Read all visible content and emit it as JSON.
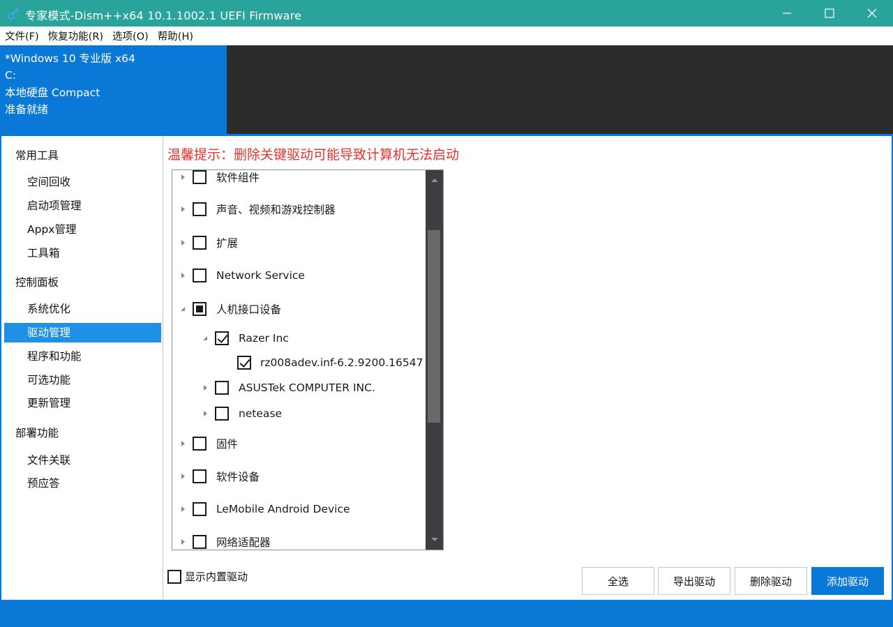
{
  "window": {
    "title": "专家模式-Dism++x64 10.1.1002.1 UEFI Firmware",
    "minimize_glyph": "—",
    "maximize_glyph": "☐",
    "close_glyph": "✕"
  },
  "menu": [
    {
      "label": "文件(F)"
    },
    {
      "label": "恢复功能(R)"
    },
    {
      "label": "选项(O)"
    },
    {
      "label": "帮助(H)"
    }
  ],
  "image_info": {
    "name": "*Windows 10 专业版 x64",
    "drive": "C:",
    "disk": "本地硬盘 Compact",
    "status": "准备就绪"
  },
  "sidebar": {
    "groups": [
      {
        "label": "常用工具",
        "items": [
          {
            "label": "空间回收"
          },
          {
            "label": "启动项管理"
          },
          {
            "label": "Appx管理"
          },
          {
            "label": "工具箱"
          }
        ]
      },
      {
        "label": "控制面板",
        "items": [
          {
            "label": "系统优化"
          },
          {
            "label": "驱动管理"
          },
          {
            "label": "程序和功能"
          },
          {
            "label": "可选功能"
          },
          {
            "label": "更新管理"
          }
        ]
      },
      {
        "label": "部署功能",
        "items": [
          {
            "label": "文件关联"
          },
          {
            "label": "预应答"
          }
        ]
      }
    ],
    "selected": "驱动管理"
  },
  "main": {
    "warning": "温馨提示：删除关键驱动可能导致计算机无法启动",
    "tree": [
      {
        "label": "软件组件",
        "state": "unchecked",
        "expander": "collapsed",
        "level": 0
      },
      {
        "label": "声音、视频和游戏控制器",
        "state": "unchecked",
        "expander": "collapsed",
        "level": 0
      },
      {
        "label": "扩展",
        "state": "unchecked",
        "expander": "collapsed",
        "level": 0
      },
      {
        "label": "Network Service",
        "state": "unchecked",
        "expander": "collapsed",
        "level": 0
      },
      {
        "label": "人机接口设备",
        "state": "partial",
        "expander": "expanded",
        "level": 0
      },
      {
        "label": "Razer Inc",
        "state": "checked",
        "expander": "expanded",
        "level": 1
      },
      {
        "label": "rz008adev.inf-6.2.9200.16547",
        "state": "checked",
        "expander": "none",
        "level": 2
      },
      {
        "label": "ASUSTek COMPUTER INC.",
        "state": "unchecked",
        "expander": "collapsed",
        "level": 1
      },
      {
        "label": "netease",
        "state": "unchecked",
        "expander": "collapsed",
        "level": 1
      },
      {
        "label": "固件",
        "state": "unchecked",
        "expander": "collapsed",
        "level": 0
      },
      {
        "label": "软件设备",
        "state": "unchecked",
        "expander": "collapsed",
        "level": 0
      },
      {
        "label": "LeMobile Android Device",
        "state": "unchecked",
        "expander": "collapsed",
        "level": 0
      },
      {
        "label": "网络适配器",
        "state": "unchecked",
        "expander": "collapsed",
        "level": 0
      }
    ],
    "show_builtin_label": "显示内置驱动",
    "buttons": {
      "select_all": "全选",
      "export": "导出驱动",
      "delete": "删除驱动",
      "add": "添加驱动"
    }
  },
  "colors": {
    "titlebar": "#2aa39a",
    "accent": "#0a78d7",
    "selected_item": "#1e90e6",
    "header_dark": "#2b2b2b",
    "warning": "#e8322b"
  }
}
